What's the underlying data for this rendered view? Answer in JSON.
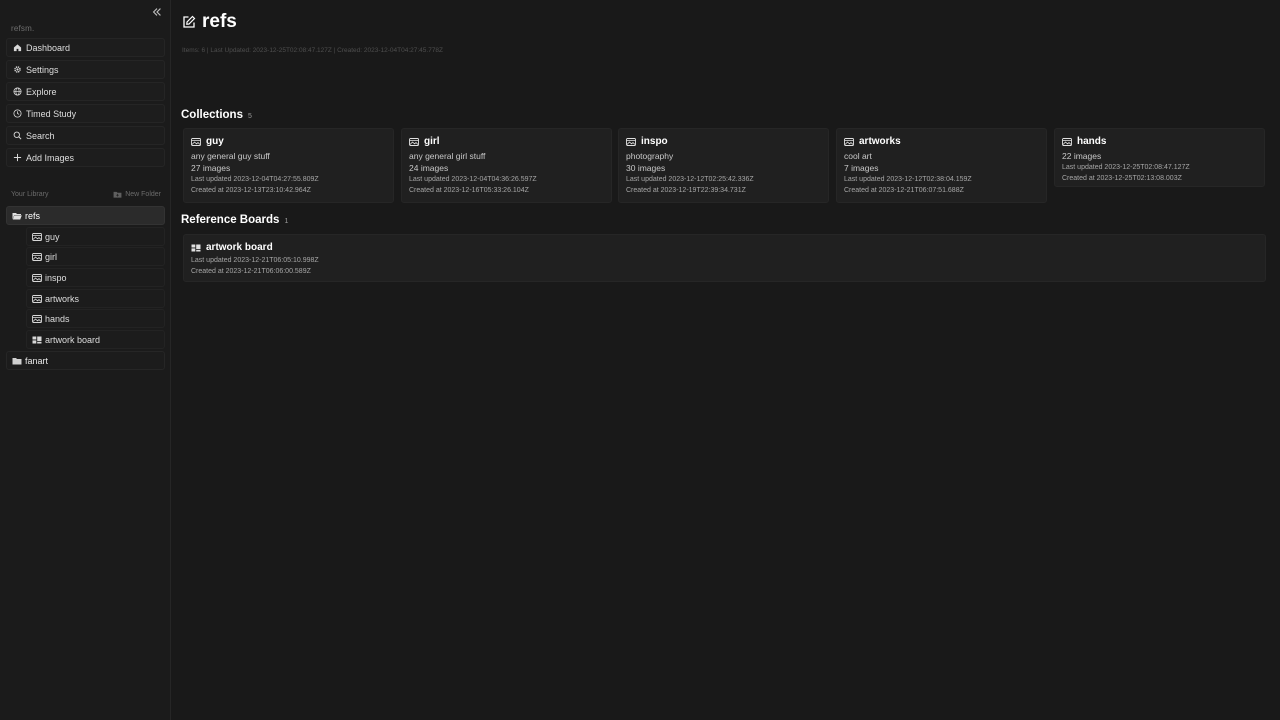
{
  "sidebar": {
    "collapse_icon": "chevrons-left-icon",
    "brand": "refsm.",
    "nav": [
      {
        "label": "Dashboard",
        "icon": "home-icon"
      },
      {
        "label": "Settings",
        "icon": "gear-icon"
      },
      {
        "label": "Explore",
        "icon": "globe-icon"
      },
      {
        "label": "Timed Study",
        "icon": "clock-icon"
      },
      {
        "label": "Search",
        "icon": "search-icon"
      },
      {
        "label": "Add Images",
        "icon": "plus-icon"
      }
    ],
    "library_label": "Your Library",
    "new_folder_label": "New Folder",
    "folders": [
      {
        "label": "refs",
        "icon": "folder-open-icon",
        "active": true,
        "children": [
          {
            "label": "guy",
            "icon": "image-collection-icon"
          },
          {
            "label": "girl",
            "icon": "image-collection-icon"
          },
          {
            "label": "inspo",
            "icon": "image-collection-icon"
          },
          {
            "label": "artworks",
            "icon": "image-collection-icon"
          },
          {
            "label": "hands",
            "icon": "image-collection-icon"
          },
          {
            "label": "artwork board",
            "icon": "board-icon"
          }
        ]
      },
      {
        "label": "fanart",
        "icon": "folder-icon",
        "active": false,
        "children": []
      }
    ]
  },
  "main": {
    "title": "refs",
    "title_icon": "edit-icon",
    "meta": "Items: 6 | Last Updated: 2023-12-25T02:08:47.127Z | Created: 2023-12-04T04:27:45.778Z",
    "collections": {
      "label": "Collections",
      "count": "5",
      "items": [
        {
          "name": "guy",
          "description": "any general guy stuff",
          "count": "27 images",
          "updated": "Last updated 2023-12-04T04:27:55.809Z",
          "created": "Created at 2023-12-13T23:10:42.964Z"
        },
        {
          "name": "girl",
          "description": "any general girl stuff",
          "count": "24 images",
          "updated": "Last updated 2023-12-04T04:36:26.597Z",
          "created": "Created at 2023-12-16T05:33:26.104Z"
        },
        {
          "name": "inspo",
          "description": "photography",
          "count": "30 images",
          "updated": "Last updated 2023-12-12T02:25:42.336Z",
          "created": "Created at 2023-12-19T22:39:34.731Z"
        },
        {
          "name": "artworks",
          "description": "cool art",
          "count": "7 images",
          "updated": "Last updated 2023-12-12T02:38:04.159Z",
          "created": "Created at 2023-12-21T06:07:51.688Z"
        },
        {
          "name": "hands",
          "description": "",
          "count": "22 images",
          "updated": "Last updated 2023-12-25T02:08:47.127Z",
          "created": "Created at 2023-12-25T02:13:08.003Z"
        }
      ]
    },
    "boards": {
      "label": "Reference Boards",
      "count": "1",
      "items": [
        {
          "name": "artwork board",
          "updated": "Last updated 2023-12-21T06:05:10.998Z",
          "created": "Created at 2023-12-21T06:06:00.589Z"
        }
      ]
    }
  },
  "colors": {
    "background": "#191919",
    "sidebar": "#1b1b1b",
    "card": "#202020",
    "active_item": "#2b2b2b",
    "text": "#ffffff",
    "muted": "#a6a6a6"
  }
}
